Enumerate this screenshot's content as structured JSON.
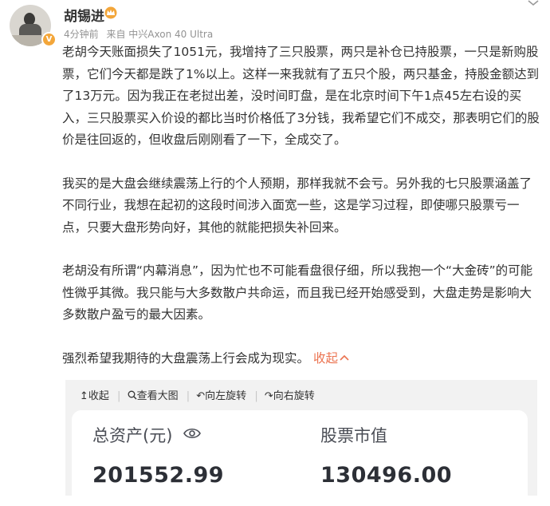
{
  "post": {
    "author": "胡锡进",
    "verified_badge": "V",
    "time": "4分钟前",
    "source": "来自 中兴Axon 40 Ultra",
    "paragraphs": [
      "老胡今天账面损失了1051元，我增持了三只股票，两只是补仓已持股票，一只是新购股票，它们今天都是跌了1%以上。这样一来我就有了五只个股，两只基金，持股金额达到了13万元。因为我正在老挝出差，没时间盯盘，是在北京时间下午1点45左右设的买入，三只股票买入价设的都比当时价格低了3分钱，我希望它们不成交，那表明它们的股价是往回返的，但收盘后刚刚看了一下，全成交了。",
      "我买的是大盘会继续震荡上行的个人预期，那样我就不会亏。另外我的七只股票涵盖了不同行业，我想在起初的这段时间涉入面宽一些，这是学习过程，即使哪只股票亏一点，只要大盘形势向好，其他的就能把损失补回来。",
      "老胡没有所谓“内幕消息”，因为忙也不可能看盘很仔细，所以我抱一个“大金砖”的可能性微乎其微。我只能与大多数散户共命运，而且我已经开始感受到，大盘走势是影响大多数散户盈亏的最大因素。",
      "强烈希望我期待的大盘震荡上行会成为现实。"
    ],
    "collapse_label": "收起",
    "collapse_arrow": "^"
  },
  "image_toolbar": {
    "collapse": "↥收起",
    "view_large": "查看大图",
    "rotate_left": "↶向左旋转",
    "rotate_right": "↷向右旋转"
  },
  "card": {
    "total_assets_label": "总资产(元)",
    "total_assets_value": "201552.99",
    "stock_value_label": "股票市值",
    "stock_value_value": "130496.00"
  },
  "colors": {
    "accent": "#eb7350",
    "crown": "#f3a63a"
  },
  "icons": [
    "crown-icon",
    "more-chevron-icon",
    "search-zoom-icon",
    "eye-icon"
  ]
}
